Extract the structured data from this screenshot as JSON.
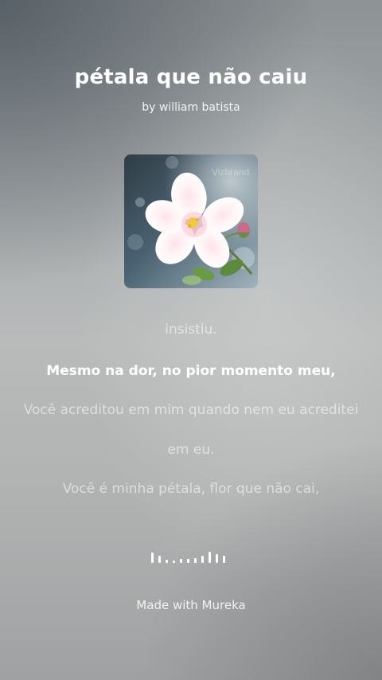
{
  "song": {
    "title": "pétala que não caiu",
    "byline": "by william batista"
  },
  "cover_art": {
    "watermark": "Vizbrand",
    "subject": "white-flower-icon"
  },
  "lyrics": {
    "lines": [
      "insistiu.",
      "Mesmo na dor, no pior momento meu,",
      "Você acreditou em mim quando nem eu acreditei",
      "em eu.",
      "Você é minha pétala, flor que não cai,"
    ],
    "active_index": 1
  },
  "audio_visualizer": {
    "icon": "waveform-icon",
    "bar_levels": [
      0.75,
      0.55,
      0.25,
      0.2,
      0.3,
      0.3,
      0.35,
      0.55,
      0.8,
      0.65,
      0.5
    ]
  },
  "footer": {
    "credit": "Made with Mureka"
  }
}
